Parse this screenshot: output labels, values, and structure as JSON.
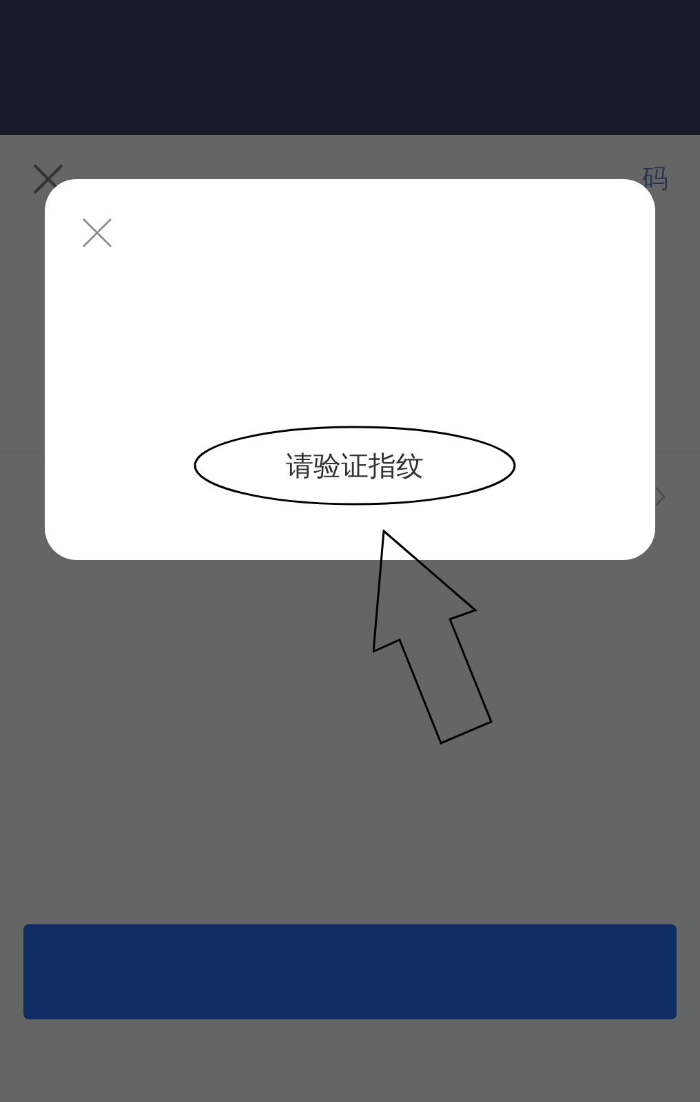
{
  "top_bar": {
    "password_link": "码"
  },
  "list": [
    {
      "kind": "plain"
    },
    {
      "kind": "chevron"
    }
  ],
  "dialog": {
    "message": "请验证指纹"
  }
}
